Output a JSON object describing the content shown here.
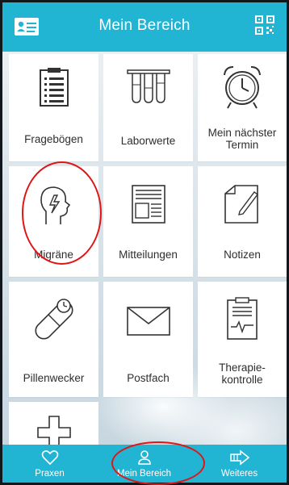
{
  "app": {
    "title": "Mein Bereich"
  },
  "colors": {
    "primary": "#22b4d3",
    "highlight_circle": "#e01616",
    "tile_bg": "#ffffff",
    "text": "#2e2e2e"
  },
  "tiles": [
    {
      "label": "Fragebögen",
      "icon": "questionnaire-icon"
    },
    {
      "label": "Laborwerte",
      "icon": "test-tubes-icon"
    },
    {
      "label": "Mein nächster Termin",
      "icon": "alarm-clock-icon"
    },
    {
      "label": "Migräne",
      "icon": "migraine-head-icon"
    },
    {
      "label": "Mitteilungen",
      "icon": "newspaper-icon"
    },
    {
      "label": "Notizen",
      "icon": "notes-pencil-icon"
    },
    {
      "label": "Pillenwecker",
      "icon": "pill-alarm-icon"
    },
    {
      "label": "Postfach",
      "icon": "envelope-icon"
    },
    {
      "label": "Therapie-kontrolle",
      "icon": "therapy-control-icon"
    },
    {
      "label": "",
      "icon": "add-plus-icon"
    }
  ],
  "bottom_nav": [
    {
      "label": "Praxen",
      "icon": "heart-icon"
    },
    {
      "label": "Mein Bereich",
      "icon": "user-icon"
    },
    {
      "label": "Weiteres",
      "icon": "arrow-right-icon"
    }
  ]
}
